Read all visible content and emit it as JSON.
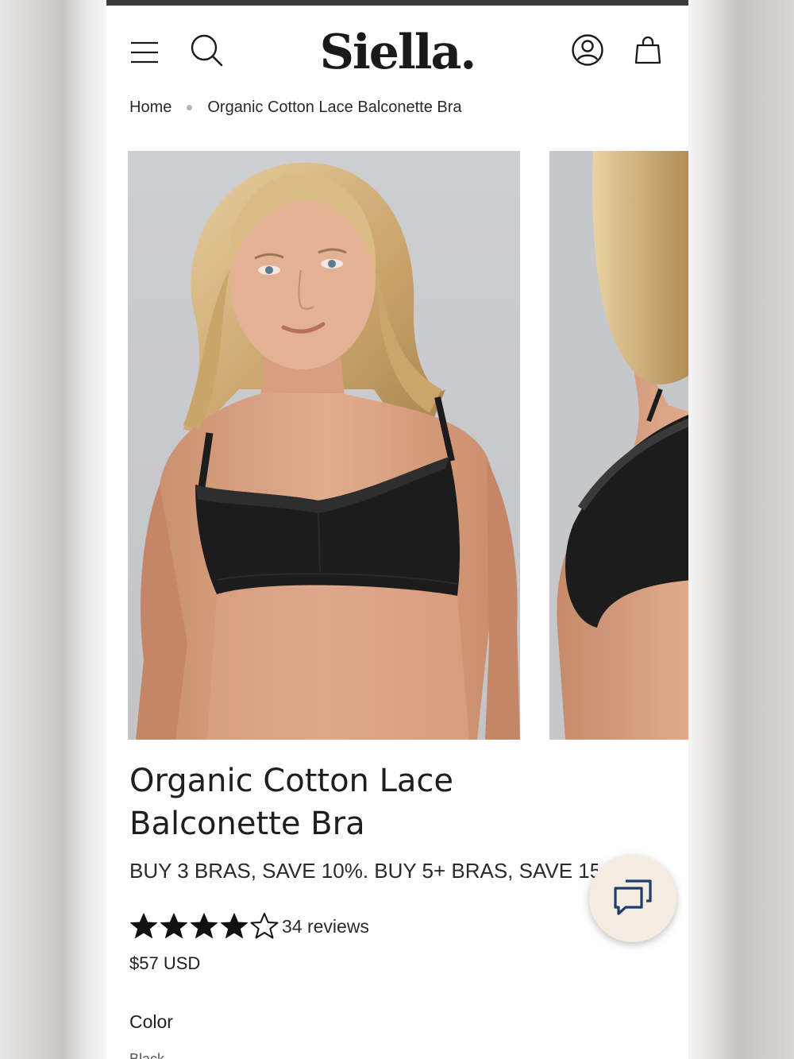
{
  "header": {
    "brand": "Siella.",
    "menu_icon": "hamburger-menu-icon",
    "search_icon": "search-icon",
    "account_icon": "account-icon",
    "cart_icon": "shopping-bag-icon"
  },
  "breadcrumb": {
    "home": "Home",
    "current": "Organic Cotton Lace Balconette Bra"
  },
  "product": {
    "title": "Organic Cotton Lace Balconette Bra",
    "promo": "BUY 3 BRAS, SAVE 10%. BUY 5+ BRAS, SAVE 15%",
    "rating": 4,
    "rating_max": 5,
    "reviews_label": "34 reviews",
    "price": "$57 USD",
    "color_label": "Color",
    "color_value": "Black"
  },
  "chat": {
    "icon": "chat-bubbles-icon"
  },
  "colors": {
    "text": "#1e1e1e",
    "chat_bg": "#f4ebe1",
    "image_bg": "#c7c8cb",
    "garment": "#1c1c1c"
  }
}
